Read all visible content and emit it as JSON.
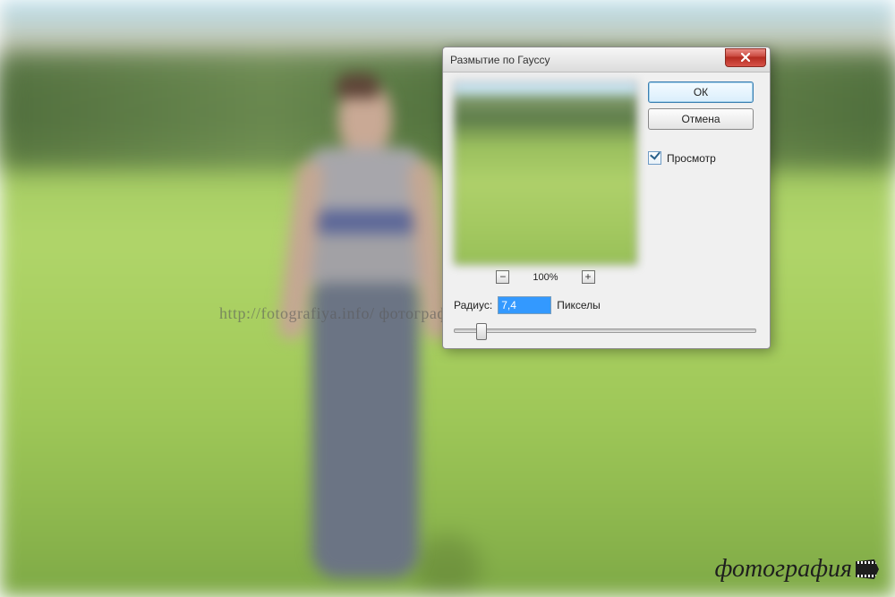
{
  "dialog": {
    "title": "Размытие по Гауссу",
    "ok_label": "ОК",
    "cancel_label": "Отмена",
    "preview_label": "Просмотр",
    "preview_checked": true,
    "zoom_value": "100%",
    "radius_label": "Радиус:",
    "radius_value": "7,4",
    "radius_unit": "Пикселы"
  },
  "watermark": {
    "center_text": "http://fotografiya.info/   фотография.инфо",
    "logo_text": "фотография"
  }
}
